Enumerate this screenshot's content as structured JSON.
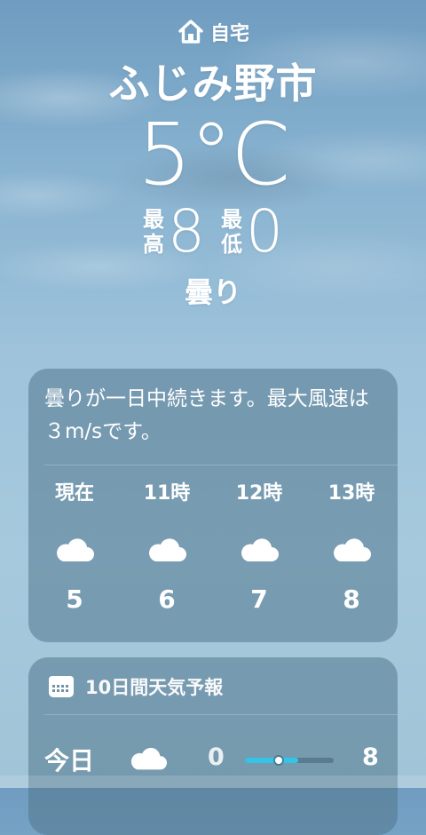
{
  "location": {
    "label": "自宅",
    "city": "ふじみ野市",
    "temperature": "5°C",
    "high_label": [
      "最",
      "高"
    ],
    "high": "8",
    "low_label": [
      "最",
      "低"
    ],
    "low": "0",
    "condition": "曇り"
  },
  "hourly_card": {
    "summary": "曇りが一日中続きます。最大風速は３m/sです。",
    "hours": [
      {
        "label": "現在",
        "icon": "cloud-icon",
        "temp": "5"
      },
      {
        "label": "11時",
        "icon": "cloud-icon",
        "temp": "6"
      },
      {
        "label": "12時",
        "icon": "cloud-icon",
        "temp": "7"
      },
      {
        "label": "13時",
        "icon": "cloud-icon",
        "temp": "8"
      }
    ]
  },
  "forecast_card": {
    "icon": "calendar-icon",
    "title": "10日間天気予報",
    "days": [
      {
        "day": "今日",
        "icon": "cloud-icon",
        "low": "0",
        "high": "8",
        "range_start": 0.0,
        "range_end": 0.6,
        "current_marker": 0.38
      }
    ]
  },
  "colors": {
    "temp_bar": "#35c4e8"
  }
}
